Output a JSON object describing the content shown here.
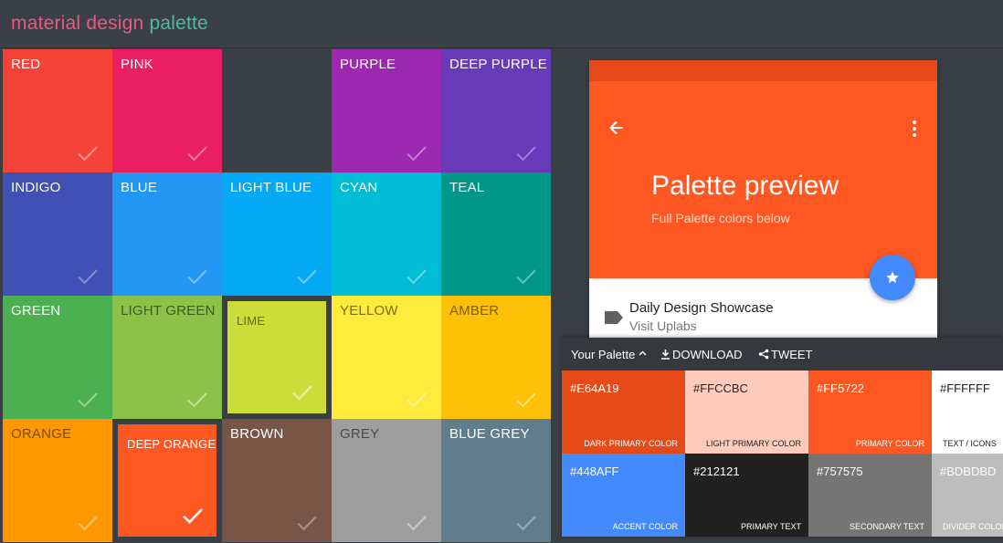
{
  "brand": {
    "word1": "material design",
    "word2": "palette"
  },
  "colors": [
    {
      "label": "RED",
      "hex": "#F44336",
      "label_color": "#ffffff",
      "check_color": "#f7998f",
      "selected": false
    },
    {
      "label": "PINK",
      "hex": "#E91E63",
      "label_color": "#ffffff",
      "check_color": "#f27aa3",
      "selected": false
    },
    {
      "label": "",
      "hex": "#3a3f45",
      "label_color": "#ffffff",
      "check_color": "",
      "selected": false
    },
    {
      "label": "PURPLE",
      "hex": "#9C27B0",
      "label_color": "#ffffff",
      "check_color": "#c77bd4",
      "selected": false
    },
    {
      "label": "DEEP PURPLE",
      "hex": "#673AB7",
      "label_color": "#ffffff",
      "check_color": "#9d80d6",
      "selected": false
    },
    {
      "label": "INDIGO",
      "hex": "#3F51B5",
      "label_color": "#ffffff",
      "check_color": "#8390d3",
      "selected": false
    },
    {
      "label": "BLUE",
      "hex": "#2196F3",
      "label_color": "#ffffff",
      "check_color": "#7ec2f7",
      "selected": false
    },
    {
      "label": "LIGHT BLUE",
      "hex": "#03A9F4",
      "label_color": "#ffffff",
      "check_color": "#6bcff8",
      "selected": false
    },
    {
      "label": "CYAN",
      "hex": "#00BCD4",
      "label_color": "#ffffff",
      "check_color": "#66d9e6",
      "selected": false
    },
    {
      "label": "TEAL",
      "hex": "#009688",
      "label_color": "#ffffff",
      "check_color": "#60c3ba",
      "selected": false
    },
    {
      "label": "GREEN",
      "hex": "#4CAF50",
      "label_color": "#ffffff",
      "check_color": "#97d19a",
      "selected": false
    },
    {
      "label": "LIGHT GREEN",
      "hex": "#8BC34A",
      "label_color": "#3d5a1b",
      "check_color": "#bde096",
      "selected": false
    },
    {
      "label": "LIME",
      "hex": "#CDDC39",
      "label_color": "#5f6812",
      "check_color": "#e5ee94",
      "selected": true
    },
    {
      "label": "YELLOW",
      "hex": "#FFEB3B",
      "label_color": "#7a6e12",
      "check_color": "#fff39c",
      "selected": false
    },
    {
      "label": "AMBER",
      "hex": "#FFC107",
      "label_color": "#7d5d00",
      "check_color": "#ffe07a",
      "selected": false
    },
    {
      "label": "ORANGE",
      "hex": "#FF9800",
      "label_color": "#7d4a00",
      "check_color": "#ffc86b",
      "selected": false
    },
    {
      "label": "DEEP ORANGE",
      "hex": "#FF5722",
      "label_color": "#ffffff",
      "check_color": "#ffffff",
      "selected": true
    },
    {
      "label": "BROWN",
      "hex": "#795548",
      "label_color": "#ffffff",
      "check_color": "#a98f85",
      "selected": false
    },
    {
      "label": "GREY",
      "hex": "#9E9E9E",
      "label_color": "#4c4c4c",
      "check_color": "#c9c9c9",
      "selected": false
    },
    {
      "label": "BLUE GREY",
      "hex": "#607D8B",
      "label_color": "#ffffff",
      "check_color": "#97adb7",
      "selected": false
    }
  ],
  "preview": {
    "status_color": "#E64A19",
    "appbar_color": "#FF5722",
    "title": "Palette preview",
    "subtitle": "Full Palette colors below",
    "fab_color": "#448AFF",
    "item_title": "Daily Design Showcase",
    "item_subtitle": "Visit Uplabs",
    "icons": {
      "back": "arrow-left-icon",
      "menu": "more-vert-icon",
      "fab": "star-icon",
      "tag": "label-tag-icon"
    }
  },
  "palette_panel": {
    "title": "Your Palette",
    "download_label": "DOWNLOAD",
    "tweet_label": "TWEET",
    "swatches": [
      {
        "hex": "#E64A19",
        "role": "DARK PRIMARY COLOR",
        "bg": "#E64A19",
        "fg": "#ffffff"
      },
      {
        "hex": "#FFCCBC",
        "role": "LIGHT PRIMARY COLOR",
        "bg": "#FFCCBC",
        "fg": "#212121"
      },
      {
        "hex": "#FF5722",
        "role": "PRIMARY COLOR",
        "bg": "#FF5722",
        "fg": "#ffffff"
      },
      {
        "hex": "#FFFFFF",
        "role": "TEXT / ICONS",
        "bg": "#FFFFFF",
        "fg": "#212121"
      },
      {
        "hex": "#448AFF",
        "role": "ACCENT COLOR",
        "bg": "#448AFF",
        "fg": "#ffffff"
      },
      {
        "hex": "#212121",
        "role": "PRIMARY TEXT",
        "bg": "#212121",
        "fg": "#ffffff"
      },
      {
        "hex": "#757575",
        "role": "SECONDARY TEXT",
        "bg": "#757575",
        "fg": "#ffffff"
      },
      {
        "hex": "#BDBDBD",
        "role": "DIVIDER COLOR",
        "bg": "#BDBDBD",
        "fg": "#ffffff"
      }
    ]
  }
}
